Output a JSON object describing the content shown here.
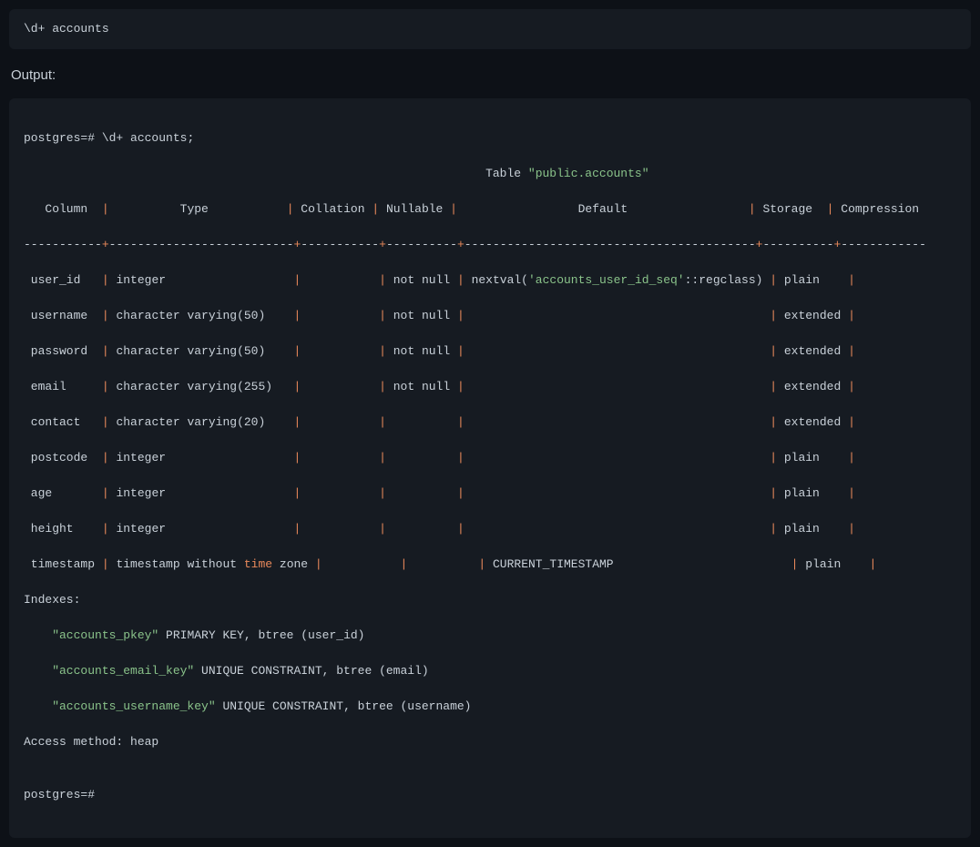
{
  "command_block": {
    "text": "\\d+ accounts"
  },
  "output_label": "Output:",
  "terminal": {
    "prompt1_a": "postgres=# ",
    "prompt1_b": "\\d+ accounts;",
    "table_title_pre": "                                                                 Table ",
    "table_title_q": "\"public.accounts\"",
    "header": {
      "col": "   Column  ",
      "type": "          Type           ",
      "coll": " Collation ",
      "null": " Nullable ",
      "def": "                 Default                 ",
      "stor": " Storage  ",
      "comp": " Compression"
    },
    "sep": {
      "a": "-----------",
      "b": "--------------------------",
      "c": "-----------",
      "d": "----------",
      "e": "-----------------------------------------",
      "f": "----------",
      "g": "------------"
    },
    "rows": [
      {
        "col": " user_id   ",
        "type": " integer                  ",
        "coll": "           ",
        "null": " not null ",
        "def": " nextval('accounts_user_id_seq'::regclass) ",
        "stor": " plain    ",
        "comp": ""
      },
      {
        "col": " username  ",
        "type": " character varying(50)    ",
        "coll": "           ",
        "null": " not null ",
        "def": "                                           ",
        "stor": " extended ",
        "comp": ""
      },
      {
        "col": " password  ",
        "type": " character varying(50)    ",
        "coll": "           ",
        "null": " not null ",
        "def": "                                           ",
        "stor": " extended ",
        "comp": ""
      },
      {
        "col": " email     ",
        "type": " character varying(255)   ",
        "coll": "           ",
        "null": " not null ",
        "def": "                                           ",
        "stor": " extended ",
        "comp": ""
      },
      {
        "col": " contact   ",
        "type": " character varying(20)    ",
        "coll": "           ",
        "null": "          ",
        "def": "                                           ",
        "stor": " extended ",
        "comp": ""
      },
      {
        "col": " postcode  ",
        "type": " integer                  ",
        "coll": "           ",
        "null": "          ",
        "def": "                                           ",
        "stor": " plain    ",
        "comp": ""
      },
      {
        "col": " age       ",
        "type": " integer                  ",
        "coll": "           ",
        "null": "          ",
        "def": "                                           ",
        "stor": " plain    ",
        "comp": ""
      },
      {
        "col": " height    ",
        "type": " integer                  ",
        "coll": "           ",
        "null": "          ",
        "def": "                                           ",
        "stor": " plain    ",
        "comp": ""
      }
    ],
    "ts_row": {
      "col": " timestamp ",
      "type_a": " timestamp without ",
      "type_time": "time",
      "type_b": " zone ",
      "coll": "           ",
      "null": "          ",
      "def": " CURRENT_TIMESTAMP                         ",
      "stor": " plain    ",
      "comp": ""
    },
    "indexes_label": "Indexes:",
    "idx1_name": "    \"accounts_pkey\"",
    "idx1_rest": " PRIMARY KEY, btree (user_id)",
    "idx2_name": "    \"accounts_email_key\"",
    "idx2_rest": " UNIQUE CONSTRAINT, btree (email)",
    "idx3_name": "    \"accounts_username_key\"",
    "idx3_rest": " UNIQUE CONSTRAINT, btree (username)",
    "access_method": "Access method: heap",
    "blank": "",
    "prompt2": "postgres=#"
  }
}
